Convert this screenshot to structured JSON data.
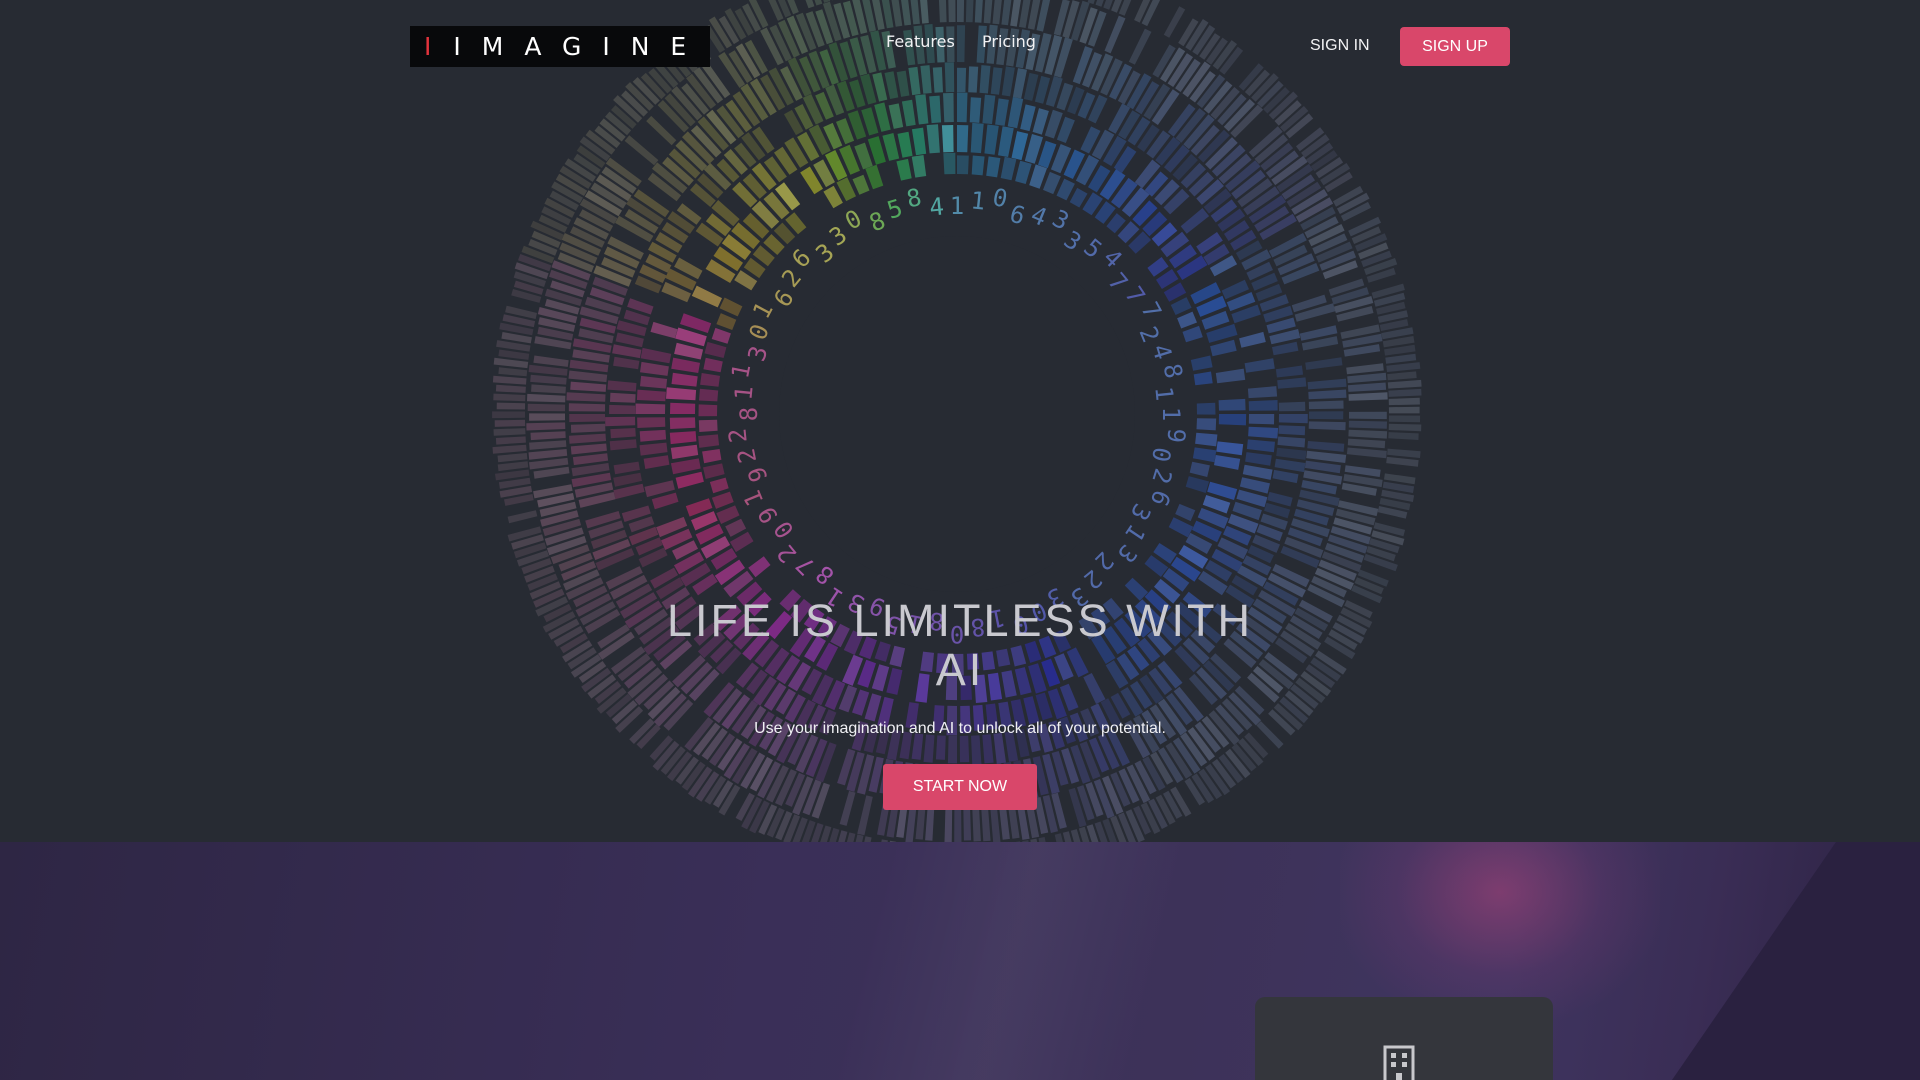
{
  "navbar": {
    "logo_accent": "I",
    "logo_text": "IMAGINE",
    "links": [
      {
        "label": "Features"
      },
      {
        "label": "Pricing"
      }
    ],
    "signin_label": "SIGN IN",
    "signup_label": "SIGN UP"
  },
  "hero": {
    "headline": "LIFE IS LIMITLESS WITH AI",
    "subtext": "Use your imagination and AI to unlock all of your potential.",
    "cta_label": "START NOW"
  },
  "features": {
    "card_icon": "building-icon"
  },
  "colors": {
    "background": "#272b33",
    "accent": "#d9476a",
    "logo_accent": "#e2333d",
    "features_band": "#3a2f58",
    "card": "#34363c"
  }
}
